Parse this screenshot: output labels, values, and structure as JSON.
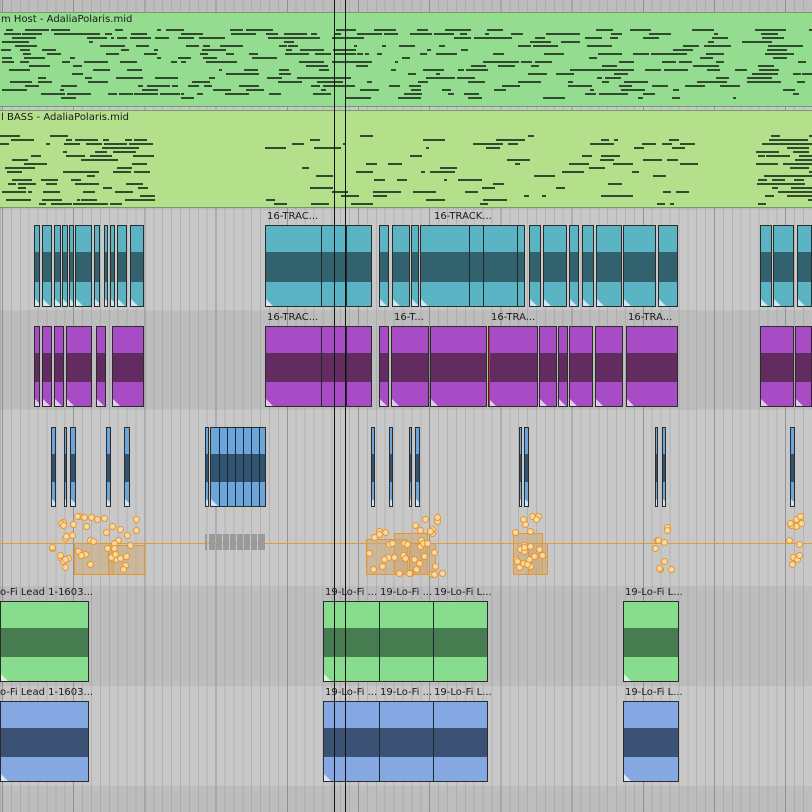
{
  "arrange": {
    "tracks": [
      {
        "id": "t1",
        "kind": "midi",
        "label": "m Host - AdaliaPolaris.mid",
        "color": "#94dc90"
      },
      {
        "id": "t2",
        "kind": "midi",
        "label": "l BASS - AdaliaPolaris.mid",
        "color": "#b4e08c"
      },
      {
        "id": "t3",
        "kind": "audio",
        "color": "#5ab4c4",
        "wave_color": "#2c545e"
      },
      {
        "id": "t4",
        "kind": "audio",
        "color": "#a84cc6",
        "wave_color": "#56274f"
      },
      {
        "id": "t5",
        "kind": "audio",
        "color": "#6aa6dc",
        "wave_color": "#26455f"
      },
      {
        "id": "t6",
        "kind": "automation",
        "line_color": "#e89a2e"
      },
      {
        "id": "t7",
        "kind": "audio",
        "color": "#88dc8e",
        "wave_color": "#3c6a45"
      },
      {
        "id": "t8",
        "kind": "audio",
        "color": "#86a8e2",
        "wave_color": "#2f4360"
      }
    ],
    "clip_labels": {
      "teal_a": "16-TRAC...",
      "teal_b": "16-TRACK...",
      "purple_a": "16-TRAC...",
      "purple_b": "16-T...",
      "purple_c": "16-TRA...",
      "purple_d": "16-TRA...",
      "green_lead": "o-Fi Lead 1-1603...",
      "blue_lead": "o-Fi Lead 1-1603...",
      "lofi_1": "19-Lo-Fi ...",
      "lofi_2": "19-Lo-Fi ...",
      "lofi_3": "19-Lo-Fi L...",
      "lofi_4": "19-Lo-Fi L..."
    }
  }
}
